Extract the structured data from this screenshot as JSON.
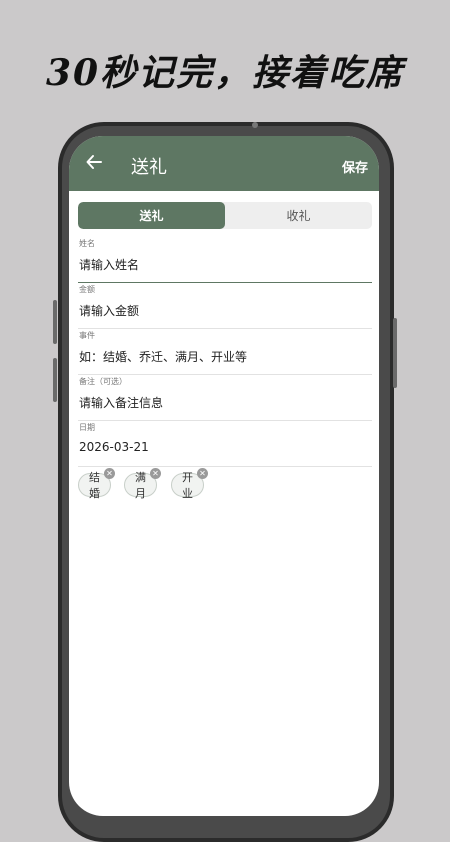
{
  "headline": "30秒记完，接着吃席",
  "appbar": {
    "back_icon": "arrow-left-icon",
    "title": "送礼",
    "save_label": "保存"
  },
  "tabs": [
    {
      "label": "送礼",
      "active": true
    },
    {
      "label": "收礼",
      "active": false
    }
  ],
  "fields": {
    "name": {
      "label": "姓名",
      "placeholder": "请输入姓名"
    },
    "amount": {
      "label": "金额",
      "placeholder": "请输入金额"
    },
    "event": {
      "label": "事件",
      "placeholder": "如：结婚、乔迁、满月、开业等"
    },
    "note": {
      "label": "备注（可选）",
      "placeholder": "请输入备注信息"
    },
    "date": {
      "label": "日期",
      "value": "2026-03-21"
    }
  },
  "chips": [
    {
      "label": "结婚"
    },
    {
      "label": "满月"
    },
    {
      "label": "开业"
    }
  ],
  "colors": {
    "accent": "#5e7763",
    "background": "#cbc9ca"
  }
}
